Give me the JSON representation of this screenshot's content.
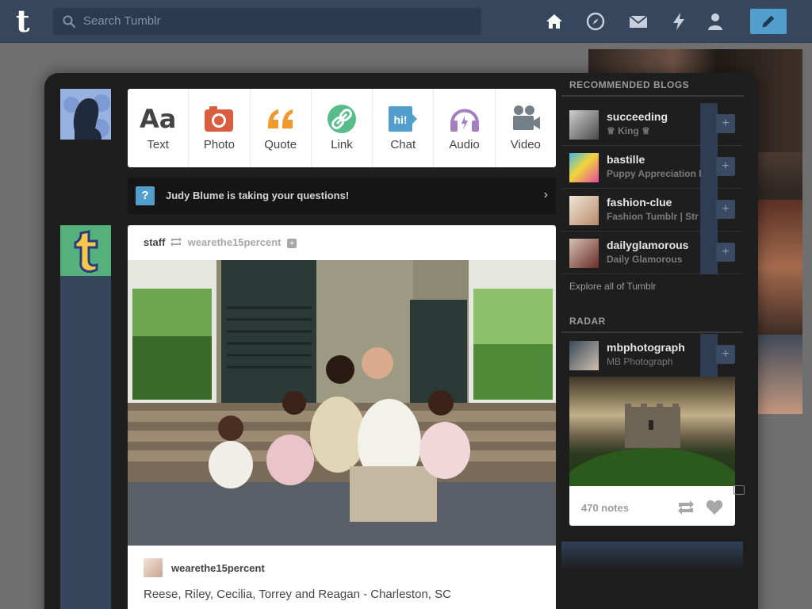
{
  "topbar": {
    "logo": "t",
    "search_placeholder": "Search Tumblr",
    "nav": [
      "home-icon",
      "explore-compass-icon",
      "inbox-mail-icon",
      "activity-lightning-icon",
      "account-person-icon"
    ],
    "compose_icon": "pencil-icon"
  },
  "post_types": [
    {
      "label": "Text",
      "icon": "text-aa-icon",
      "color": "#444444"
    },
    {
      "label": "Photo",
      "icon": "camera-icon",
      "color": "#d95e40"
    },
    {
      "label": "Quote",
      "icon": "quote-icon",
      "color": "#f2992e"
    },
    {
      "label": "Link",
      "icon": "link-icon",
      "color": "#56bc8a"
    },
    {
      "label": "Chat",
      "icon": "chat-bubble-icon",
      "color": "#529ecc"
    },
    {
      "label": "Audio",
      "icon": "headphones-icon",
      "color": "#a77dc2"
    },
    {
      "label": "Video",
      "icon": "video-camera-icon",
      "color": "#748089"
    }
  ],
  "banner": {
    "icon_text": "?",
    "text": "Judy Blume is taking your questions!"
  },
  "post": {
    "author": "staff",
    "reblogged_from": "wearethe15percent",
    "caption_author": "wearethe15percent",
    "caption": "Reese, Riley, Cecilia, Torrey and Reagan - Charleston, SC"
  },
  "sidebar": {
    "recommended_title": "RECOMMENDED BLOGS",
    "blogs": [
      {
        "name": "succeeding",
        "desc": "♕ King ♕"
      },
      {
        "name": "bastille",
        "desc": "Puppy Appreciation I"
      },
      {
        "name": "fashion-clue",
        "desc": "Fashion Tumblr | Str"
      },
      {
        "name": "dailyglamorous",
        "desc": "Daily Glamorous"
      }
    ],
    "follow_label": "+",
    "explore": "Explore all of Tumblr",
    "radar_title": "RADAR",
    "radar_blog": {
      "name": "mbphotograph",
      "desc": "MB Photograph"
    },
    "radar_notes": "470 notes"
  },
  "colors": {
    "topbar": "#36465d",
    "accent": "#529ecc",
    "panel": "#1e1e1e"
  }
}
